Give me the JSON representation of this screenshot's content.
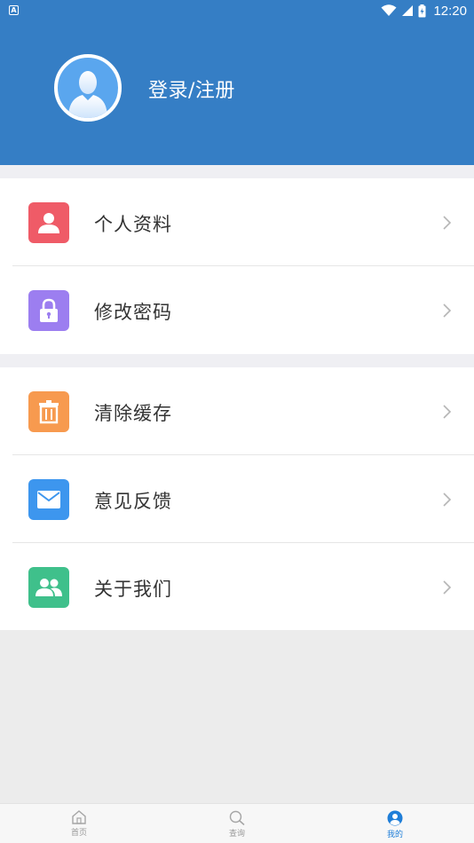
{
  "status_bar": {
    "time": "12:20",
    "notification_badge": "A"
  },
  "header": {
    "login_label": "登录/注册",
    "background": "#357ec5"
  },
  "menu_groups": [
    {
      "items": [
        {
          "label": "个人资料",
          "icon": "person-icon",
          "color": "#ef5b67"
        },
        {
          "label": "修改密码",
          "icon": "lock-icon",
          "color": "#9c7ef0"
        }
      ]
    },
    {
      "items": [
        {
          "label": "清除缓存",
          "icon": "trash-icon",
          "color": "#f79a4f"
        },
        {
          "label": "意见反馈",
          "icon": "mail-icon",
          "color": "#3d96ee"
        },
        {
          "label": "关于我们",
          "icon": "group-icon",
          "color": "#3fc08b"
        }
      ]
    }
  ],
  "tabbar": {
    "active_color": "#1f7ed8",
    "tabs": [
      {
        "label": "首页",
        "icon": "home-icon",
        "active": false
      },
      {
        "label": "查询",
        "icon": "search-icon",
        "active": false
      },
      {
        "label": "我的",
        "icon": "profile-icon",
        "active": true
      }
    ]
  }
}
